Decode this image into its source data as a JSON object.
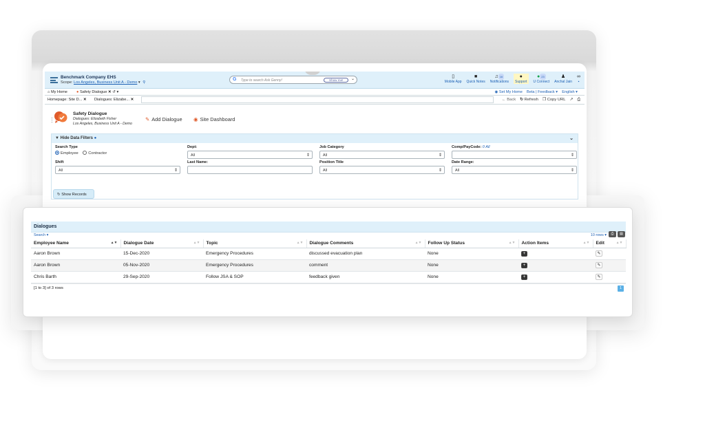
{
  "app": {
    "company": "Benchmark Company EHS",
    "scope_label": "Scope:",
    "scope_value": "Los Angeles, Business Unit A - Demo",
    "search_placeholder": "Type to search Ask Genny!",
    "show_me": "Show me!",
    "top_icons": [
      {
        "label": "Mobile App",
        "icon": "mobile-icon"
      },
      {
        "label": "Quick Notes",
        "icon": "notes-icon"
      },
      {
        "label": "Notifications",
        "icon": "bell-icon",
        "badge": "16"
      },
      {
        "label": "Support",
        "icon": "info-icon"
      },
      {
        "label": "U Connect",
        "icon": "chat-icon",
        "badge": "23"
      },
      {
        "label": "Anchal Jain",
        "icon": "user-icon"
      }
    ]
  },
  "tabs": {
    "home": "My Home",
    "current": "Safety Dialogue",
    "set_home": "Set My Home",
    "beta": "Beta | Feedback",
    "language": "English"
  },
  "crumbs": {
    "first": "Homepage: Site D...",
    "second": "Dialogues: Elizabe...",
    "back": "Back",
    "refresh": "Refresh",
    "copy_url": "Copy URL"
  },
  "page": {
    "title": "Safety Dialogue",
    "subtitle": "Dialogues: Elizabeth Fisher",
    "location": "Los Angeles, Business Unit A - Demo",
    "add_button": "Add Dialogue",
    "dashboard_button": "Site Dashboard"
  },
  "filters": {
    "header": "Hide Data Filters",
    "search_type_label": "Search Type",
    "employee": "Employee",
    "contractor": "Contractor",
    "dept_label": "Dept:",
    "dept_value": "All",
    "job_category_label": "Job Category",
    "job_category_value": "All",
    "comp_label": "Comp/PayCode:",
    "comp_all": "0 All",
    "shift_label": "Shift",
    "shift_value": "All",
    "last_name_label": "Last Name:",
    "position_label": "Position Title",
    "position_value": "All",
    "date_range_label": "Date Range:",
    "date_range_value": "All",
    "show_records": "Show Records"
  },
  "grid": {
    "title": "Dialogues",
    "search_link": "Search",
    "rows_selector": "10 rows",
    "columns": [
      "Employee Name",
      "Dialogue Date",
      "Topic",
      "Dialogue Comments",
      "Follow Up Status",
      "Action Items",
      "Edit"
    ],
    "rows": [
      {
        "name": "Aaron Brown",
        "date": "15-Dec-2020",
        "topic": "Emergency Procedures",
        "comment": "discussed evacuation plan",
        "status": "None"
      },
      {
        "name": "Aaron Brown",
        "date": "05-Nov-2020",
        "topic": "Emergency Procedures",
        "comment": "comment",
        "status": "None"
      },
      {
        "name": "Chris Barth",
        "date": "29-Sep-2020",
        "topic": "Follow JSA & SOP",
        "comment": "feedback given",
        "status": "None"
      }
    ],
    "footer": "[1 to 3] of 3 rows",
    "page": "1"
  },
  "colors": {
    "accent": "#1a5fb4",
    "header_bg": "#dff0fa",
    "orange": "#e05b2b"
  }
}
